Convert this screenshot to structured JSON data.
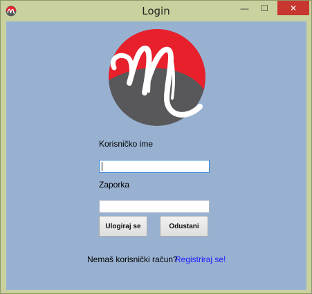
{
  "window": {
    "title": "Login",
    "controls": {
      "minimize": "—",
      "maximize": "☐",
      "close": "✕"
    }
  },
  "form": {
    "username_label": "Korisničko ime",
    "username_value": "",
    "password_label": "Zaporka",
    "password_value": "",
    "login_button": "Ulogiraj se",
    "cancel_button": "Odustani"
  },
  "footer": {
    "prompt": "Nemaš korisnički račun?",
    "register_link": "Registriraj se!"
  },
  "colors": {
    "background": "#98b1d0",
    "logo_red": "#e8202c",
    "logo_gray": "#58585a",
    "link": "#1a1aff",
    "close_button": "#c7372f"
  },
  "logo": {
    "icon": "m-logo-icon"
  }
}
